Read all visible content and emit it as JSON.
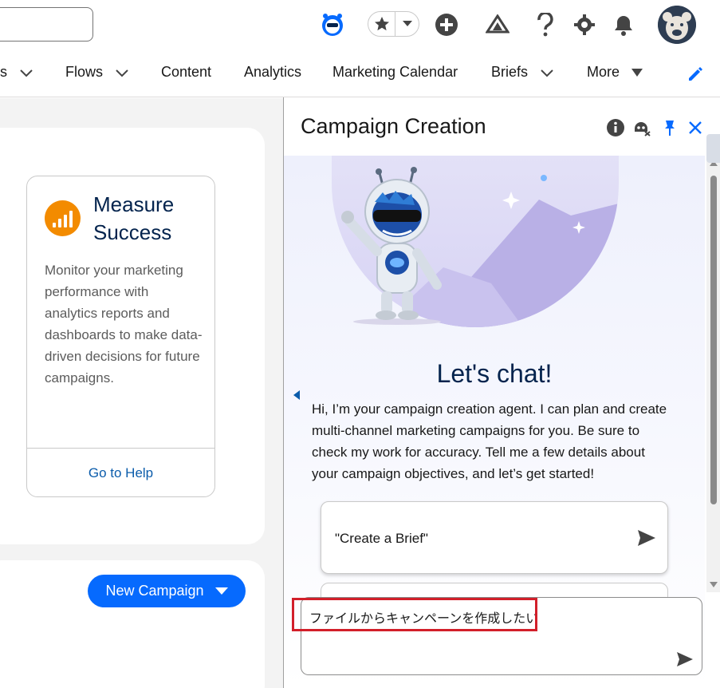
{
  "header": {
    "icons": [
      "astro-icon",
      "star-icon",
      "chevron-down-icon",
      "plus-icon",
      "trailhead-icon",
      "help-icon",
      "gear-icon",
      "bell-icon",
      "avatar-bear"
    ]
  },
  "nav": {
    "items": [
      {
        "label": "s",
        "has_dropdown": true
      },
      {
        "label": "Flows",
        "has_dropdown": true
      },
      {
        "label": "Content",
        "has_dropdown": false
      },
      {
        "label": "Analytics",
        "has_dropdown": false
      },
      {
        "label": "Marketing Calendar",
        "has_dropdown": false
      },
      {
        "label": "Briefs",
        "has_dropdown": true
      },
      {
        "label": "More",
        "has_dropdown": true
      }
    ]
  },
  "tile": {
    "title": "Measure Success",
    "description": "Monitor your marketing performance with analytics reports and dashboards to make data-driven decisions for future campaigns.",
    "link": "Go to Help"
  },
  "new_campaign": {
    "label": "New Campaign"
  },
  "panel": {
    "title": "Campaign Creation",
    "heading": "Let's chat!",
    "intro": "Hi, I’m your campaign creation agent. I can plan and create multi-channel marketing campaigns for you. Be sure to check my work for accuracy. Tell me a few details about your campaign objectives, and let’s get started!",
    "prompts": [
      "\"Create a Brief\""
    ]
  },
  "input": {
    "value": "ファイルからキャンペーンを作成したい"
  },
  "colors": {
    "brand_blue": "#066afe",
    "title_navy": "#03234d",
    "link_blue": "#0b5cab",
    "tile_orange": "#f38b00",
    "highlight_red": "#d21f2a"
  }
}
